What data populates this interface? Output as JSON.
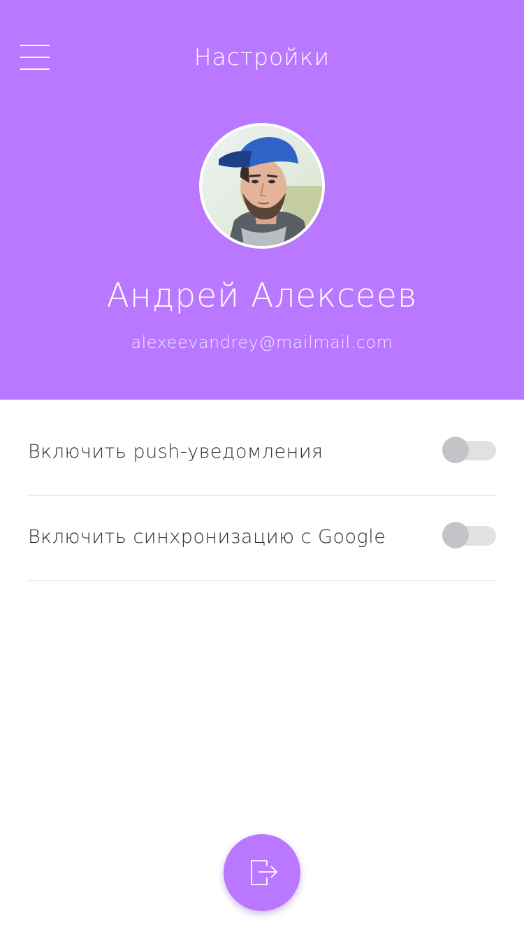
{
  "header": {
    "title": "Настройки",
    "menu_icon": "hamburger-menu-icon",
    "background_color": "#b978ff"
  },
  "profile": {
    "avatar_alt": "avatar",
    "name": "Андрей Алексеев",
    "email": "alexeevandrey@mailmail.com"
  },
  "settings": [
    {
      "label": "Включить push-уведомления",
      "enabled": false
    },
    {
      "label": "Включить синхронизацию с Google",
      "enabled": false
    }
  ],
  "logout": {
    "icon": "logout-icon",
    "color": "#b978ff"
  }
}
